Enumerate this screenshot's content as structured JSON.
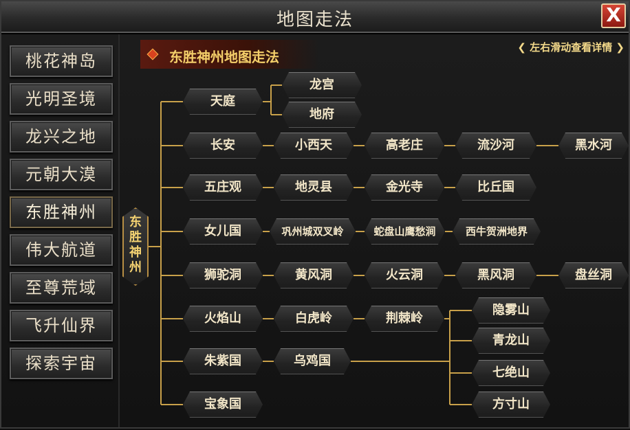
{
  "window": {
    "title": "地图走法",
    "close_label": "X"
  },
  "sidebar": {
    "items": [
      {
        "label": "桃花神岛"
      },
      {
        "label": "光明圣境"
      },
      {
        "label": "龙兴之地"
      },
      {
        "label": "元朝大漠"
      },
      {
        "label": "东胜神州"
      },
      {
        "label": "伟大航道"
      },
      {
        "label": "至尊荒域"
      },
      {
        "label": "飞升仙界"
      },
      {
        "label": "探索宇宙"
      }
    ],
    "active_index": 4
  },
  "header": {
    "title": "东胜神州地图走法",
    "hint": "左右滑动查看详情"
  },
  "map": {
    "root": "东胜神州",
    "nodes": {
      "tianting": "天庭",
      "longgong": "龙宫",
      "difu": "地府",
      "changan": "长安",
      "xiaoxitian": "小西天",
      "gaolaozhuang": "高老庄",
      "liushahe": "流沙河",
      "heishuihe": "黑水河",
      "wuzhuangguan": "五庄观",
      "dilingxian": "地灵县",
      "jinguangsi": "金光寺",
      "biqiuguo": "比丘国",
      "nverguo": "女儿国",
      "gongzhou": "巩州城双叉岭",
      "shepan": "蛇盘山鹰愁涧",
      "xiniu": "西牛贺洲地界",
      "shituodong": "狮驼洞",
      "huangfengdong": "黄风洞",
      "huoyundong": "火云洞",
      "heifengdong": "黑风洞",
      "pansidong": "盘丝洞",
      "huoyanshan": "火焰山",
      "baihuling": "白虎岭",
      "jingjiling": "荆棘岭",
      "zhuziguo": "朱紫国",
      "wujiguo": "乌鸡国",
      "yinwushan": "隐雾山",
      "qinglongshan": "青龙山",
      "qijueshan": "七绝山",
      "fangcunshan": "方寸山",
      "baoxiangguo": "宝象国"
    }
  },
  "colors": {
    "accent_gold": "#f4cf6a",
    "line_gold": "#c9a14a",
    "close_red": "#c0301f"
  }
}
